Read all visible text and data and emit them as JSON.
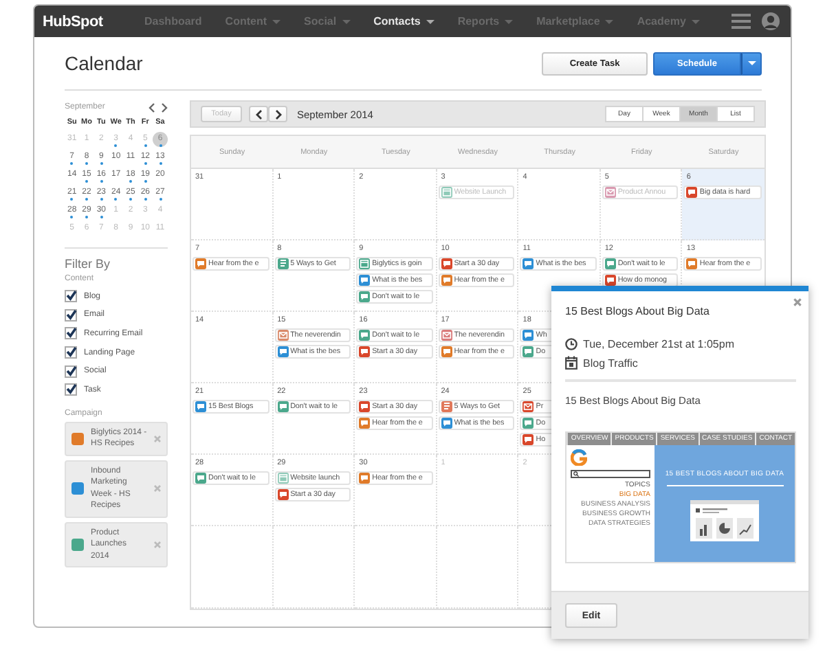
{
  "nav": {
    "logo": "HubSpot",
    "items": [
      {
        "label": "Dashboard",
        "selected": false,
        "dropdown": false
      },
      {
        "label": "Content",
        "selected": false,
        "dropdown": true
      },
      {
        "label": "Social",
        "selected": false,
        "dropdown": true
      },
      {
        "label": "Contacts",
        "selected": true,
        "dropdown": true
      },
      {
        "label": "Reports",
        "selected": false,
        "dropdown": true
      },
      {
        "label": "Marketplace",
        "selected": false,
        "dropdown": true
      },
      {
        "label": "Academy",
        "selected": false,
        "dropdown": true
      }
    ]
  },
  "page": {
    "title": "Calendar",
    "buttons": {
      "create": "Create Task",
      "schedule": "Schedule"
    }
  },
  "mini_calendar": {
    "month": "September",
    "weekdays": [
      "Su",
      "Mo",
      "Tu",
      "We",
      "Th",
      "Fr",
      "Sa"
    ],
    "days": [
      {
        "label": "31",
        "muted": true,
        "dot": false,
        "selected": false
      },
      {
        "label": "1",
        "muted": true,
        "dot": false,
        "selected": false
      },
      {
        "label": "2",
        "muted": true,
        "dot": false,
        "selected": false
      },
      {
        "label": "3",
        "muted": true,
        "dot": true,
        "selected": false
      },
      {
        "label": "4",
        "muted": true,
        "dot": false,
        "selected": false
      },
      {
        "label": "5",
        "muted": true,
        "dot": true,
        "selected": false
      },
      {
        "label": "6",
        "muted": false,
        "dot": true,
        "selected": true
      },
      {
        "label": "7",
        "muted": false,
        "dot": true,
        "selected": false
      },
      {
        "label": "8",
        "muted": false,
        "dot": true,
        "selected": false
      },
      {
        "label": "9",
        "muted": false,
        "dot": true,
        "selected": false
      },
      {
        "label": "10",
        "muted": false,
        "dot": false,
        "selected": false
      },
      {
        "label": "11",
        "muted": false,
        "dot": false,
        "selected": false
      },
      {
        "label": "12",
        "muted": false,
        "dot": true,
        "selected": false
      },
      {
        "label": "13",
        "muted": false,
        "dot": true,
        "selected": false
      },
      {
        "label": "14",
        "muted": false,
        "dot": false,
        "selected": false
      },
      {
        "label": "15",
        "muted": false,
        "dot": true,
        "selected": false
      },
      {
        "label": "16",
        "muted": false,
        "dot": true,
        "selected": false
      },
      {
        "label": "17",
        "muted": false,
        "dot": false,
        "selected": false
      },
      {
        "label": "18",
        "muted": false,
        "dot": true,
        "selected": false
      },
      {
        "label": "19",
        "muted": false,
        "dot": true,
        "selected": false
      },
      {
        "label": "20",
        "muted": false,
        "dot": false,
        "selected": false
      },
      {
        "label": "21",
        "muted": false,
        "dot": true,
        "selected": false
      },
      {
        "label": "22",
        "muted": false,
        "dot": true,
        "selected": false
      },
      {
        "label": "23",
        "muted": false,
        "dot": true,
        "selected": false
      },
      {
        "label": "24",
        "muted": false,
        "dot": true,
        "selected": false
      },
      {
        "label": "25",
        "muted": false,
        "dot": true,
        "selected": false
      },
      {
        "label": "26",
        "muted": false,
        "dot": true,
        "selected": false
      },
      {
        "label": "27",
        "muted": false,
        "dot": true,
        "selected": false
      },
      {
        "label": "28",
        "muted": false,
        "dot": true,
        "selected": false
      },
      {
        "label": "29",
        "muted": false,
        "dot": true,
        "selected": false
      },
      {
        "label": "30",
        "muted": false,
        "dot": true,
        "selected": false
      },
      {
        "label": "1",
        "muted": true,
        "dot": false,
        "selected": false
      },
      {
        "label": "2",
        "muted": true,
        "dot": false,
        "selected": false
      },
      {
        "label": "3",
        "muted": true,
        "dot": false,
        "selected": false
      },
      {
        "label": "4",
        "muted": true,
        "dot": false,
        "selected": false
      },
      {
        "label": "5",
        "muted": true,
        "dot": false,
        "selected": false
      },
      {
        "label": "6",
        "muted": true,
        "dot": false,
        "selected": false
      },
      {
        "label": "7",
        "muted": true,
        "dot": false,
        "selected": false
      },
      {
        "label": "8",
        "muted": true,
        "dot": false,
        "selected": false
      },
      {
        "label": "9",
        "muted": true,
        "dot": false,
        "selected": false
      },
      {
        "label": "10",
        "muted": true,
        "dot": false,
        "selected": false
      },
      {
        "label": "11",
        "muted": true,
        "dot": false,
        "selected": false
      }
    ]
  },
  "filter": {
    "title": "Filter By",
    "content_label": "Content",
    "content": [
      {
        "label": "Blog",
        "checked": true
      },
      {
        "label": "Email",
        "checked": true
      },
      {
        "label": "Recurring Email",
        "checked": true
      },
      {
        "label": "Landing Page",
        "checked": true
      },
      {
        "label": "Social",
        "checked": true
      },
      {
        "label": "Task",
        "checked": true
      }
    ],
    "campaign_label": "Campaign",
    "campaigns": [
      {
        "name": "Biglytics 2014 - HS Recipes",
        "color": "#e07b2a"
      },
      {
        "name": "Inbound Marketing Week - HS Recipes",
        "color": "#2d8fd5"
      },
      {
        "name": "Product Launches 2014",
        "color": "#4ba88c"
      }
    ]
  },
  "toolbar": {
    "today": "Today",
    "today_disabled": true,
    "period": "September 2014",
    "views": [
      {
        "label": "Day",
        "selected": false
      },
      {
        "label": "Week",
        "selected": false
      },
      {
        "label": "Month",
        "selected": true
      },
      {
        "label": "List",
        "selected": false
      }
    ]
  },
  "calendar": {
    "weekdays": [
      "Sunday",
      "Monday",
      "Tuesday",
      "Wednesday",
      "Thursday",
      "Friday",
      "Saturday"
    ],
    "weeks": [
      {
        "days": [
          {
            "number": "31",
            "muted": false,
            "selected": false
          },
          {
            "number": "1",
            "muted": false,
            "selected": false
          },
          {
            "number": "2",
            "muted": false,
            "selected": false
          },
          {
            "number": "3",
            "muted": false,
            "selected": false,
            "events": [
              {
                "kind": "page",
                "color": "#8fcab8",
                "title": "Website Launch",
                "dimmed": true
              }
            ]
          },
          {
            "number": "4",
            "muted": false,
            "selected": false
          },
          {
            "number": "5",
            "muted": false,
            "selected": false,
            "events": [
              {
                "kind": "email",
                "color": "#d99ab0",
                "title": "Product Annou",
                "dimmed": true
              }
            ]
          },
          {
            "number": "6",
            "muted": false,
            "selected": true,
            "events": [
              {
                "kind": "social",
                "color": "#d9472b",
                "title": "Big data is hard",
                "dimmed": false
              }
            ]
          }
        ]
      },
      {
        "days": [
          {
            "number": "7",
            "muted": false,
            "selected": false,
            "events": [
              {
                "kind": "social",
                "color": "#e07b2a",
                "title": "Hear from the e",
                "dimmed": false
              }
            ]
          },
          {
            "number": "8",
            "muted": false,
            "selected": false,
            "events": [
              {
                "kind": "blog",
                "color": "#4ba88c",
                "title": "5 Ways to Get",
                "dimmed": false
              }
            ]
          },
          {
            "number": "9",
            "muted": false,
            "selected": false,
            "events": [
              {
                "kind": "page",
                "color": "#4ba88c",
                "title": "Biglytics is goin",
                "dimmed": false
              },
              {
                "kind": "social",
                "color": "#2d8fd5",
                "title": "What is the bes",
                "dimmed": false
              },
              {
                "kind": "social",
                "color": "#4ba88c",
                "title": "Don't wait to le",
                "dimmed": false
              }
            ]
          },
          {
            "number": "10",
            "muted": false,
            "selected": false,
            "events": [
              {
                "kind": "social",
                "color": "#d9472b",
                "title": "Start a 30 day",
                "dimmed": false
              },
              {
                "kind": "social",
                "color": "#e07b2a",
                "title": "Hear from the e",
                "dimmed": false
              }
            ]
          },
          {
            "number": "11",
            "muted": false,
            "selected": false,
            "events": [
              {
                "kind": "social",
                "color": "#2d8fd5",
                "title": "What is the bes",
                "dimmed": false
              }
            ]
          },
          {
            "number": "12",
            "muted": false,
            "selected": false,
            "events": [
              {
                "kind": "social",
                "color": "#4ba88c",
                "title": "Don't wait to le",
                "dimmed": false
              },
              {
                "kind": "social",
                "color": "#d9472b",
                "title": "How do monog",
                "dimmed": false
              }
            ]
          },
          {
            "number": "13",
            "muted": false,
            "selected": false,
            "events": [
              {
                "kind": "social",
                "color": "#e07b2a",
                "title": "Hear from the e",
                "dimmed": false
              }
            ]
          }
        ]
      },
      {
        "days": [
          {
            "number": "14",
            "muted": false,
            "selected": false
          },
          {
            "number": "15",
            "muted": false,
            "selected": false,
            "events": [
              {
                "kind": "email",
                "color": "#d98a6a",
                "title": "The neverendin",
                "dimmed": false
              },
              {
                "kind": "social",
                "color": "#2d8fd5",
                "title": "What is the bes",
                "dimmed": false
              }
            ]
          },
          {
            "number": "16",
            "muted": false,
            "selected": false,
            "events": [
              {
                "kind": "social",
                "color": "#4ba88c",
                "title": "Don't wait to le",
                "dimmed": false
              },
              {
                "kind": "social",
                "color": "#d9472b",
                "title": "Start a 30 day",
                "dimmed": false
              }
            ]
          },
          {
            "number": "17",
            "muted": false,
            "selected": false,
            "events": [
              {
                "kind": "email",
                "color": "#d97a7a",
                "title": "The neverendin",
                "dimmed": false
              },
              {
                "kind": "social",
                "color": "#e07b2a",
                "title": "Hear from the e",
                "dimmed": false
              }
            ]
          },
          {
            "number": "18",
            "muted": false,
            "selected": false,
            "events": [
              {
                "kind": "social",
                "color": "#2d8fd5",
                "title": "Wh",
                "dimmed": false
              },
              {
                "kind": "social",
                "color": "#4ba88c",
                "title": "Do",
                "dimmed": false
              }
            ]
          }
        ]
      },
      {
        "days": [
          {
            "number": "21",
            "muted": false,
            "selected": false,
            "events": [
              {
                "kind": "social",
                "color": "#2d8fd5",
                "title": "15 Best Blogs",
                "dimmed": false
              }
            ]
          },
          {
            "number": "22",
            "muted": false,
            "selected": false,
            "events": [
              {
                "kind": "social",
                "color": "#4ba88c",
                "title": "Don't wait to le",
                "dimmed": false
              }
            ]
          },
          {
            "number": "23",
            "muted": false,
            "selected": false,
            "events": [
              {
                "kind": "social",
                "color": "#d9472b",
                "title": "Start a 30 day",
                "dimmed": false
              },
              {
                "kind": "social",
                "color": "#e07b2a",
                "title": "Hear from the e",
                "dimmed": false
              }
            ]
          },
          {
            "number": "24",
            "muted": false,
            "selected": false,
            "events": [
              {
                "kind": "blog",
                "color": "#e0785a",
                "title": "5 Ways to Get",
                "dimmed": false
              },
              {
                "kind": "social",
                "color": "#2d8fd5",
                "title": "What is the bes",
                "dimmed": false
              }
            ]
          },
          {
            "number": "25",
            "muted": false,
            "selected": false,
            "events": [
              {
                "kind": "email",
                "color": "#d9472b",
                "title": "Pr",
                "dimmed": false
              },
              {
                "kind": "social",
                "color": "#4ba88c",
                "title": "Do",
                "dimmed": false
              },
              {
                "kind": "social",
                "color": "#d9472b",
                "title": "Ho",
                "dimmed": false
              }
            ]
          }
        ]
      },
      {
        "days": [
          {
            "number": "28",
            "muted": false,
            "selected": false,
            "events": [
              {
                "kind": "social",
                "color": "#4ba88c",
                "title": "Don't wait to le",
                "dimmed": false
              }
            ]
          },
          {
            "number": "29",
            "muted": false,
            "selected": false,
            "events": [
              {
                "kind": "page",
                "color": "#8fcab8",
                "title": "Website launch",
                "dimmed": false
              },
              {
                "kind": "social",
                "color": "#d9472b",
                "title": "Start a 30 day",
                "dimmed": false
              }
            ]
          },
          {
            "number": "30",
            "muted": false,
            "selected": false,
            "events": [
              {
                "kind": "social",
                "color": "#e07b2a",
                "title": "Hear from the e",
                "dimmed": false
              }
            ]
          },
          {
            "number": "1",
            "muted": true,
            "selected": false
          },
          {
            "number": "2",
            "muted": true,
            "selected": false
          }
        ]
      }
    ]
  },
  "popover": {
    "title": "15 Best Blogs About Big Data",
    "datetime": "Tue, December 21st at 1:05pm",
    "campaign": "Blog Traffic",
    "body_title": "15 Best Blogs About Big Data",
    "edit": "Edit",
    "preview": {
      "nav": [
        "OVERVIEW",
        "PRODUCTS",
        "SERVICES",
        "CASE STUDIES",
        "CONTACT"
      ],
      "topics_label": "TOPICS",
      "topics": [
        {
          "label": "BIG DATA",
          "selected": true
        },
        {
          "label": "BUSINESS ANALYSIS",
          "selected": false
        },
        {
          "label": "BUSINESS GROWTH",
          "selected": false
        },
        {
          "label": "DATA STRATEGIES",
          "selected": false
        }
      ],
      "headline": "15 BEST BLOGS ABOUT BIG DATA"
    }
  }
}
